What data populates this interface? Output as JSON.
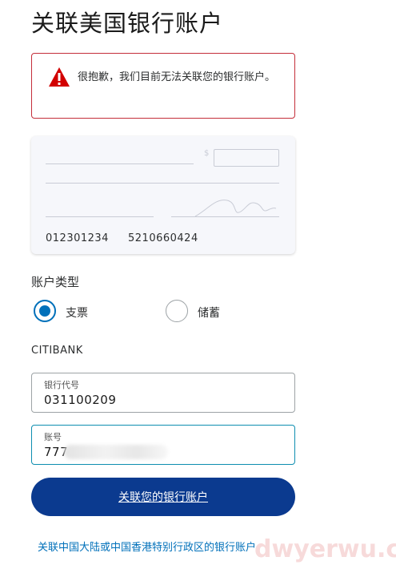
{
  "page": {
    "title": "关联美国银行账户"
  },
  "alert": {
    "message": "很抱歉，我们目前无法关联您的银行账户。",
    "icon": "warning-icon",
    "color": "#c42e3a"
  },
  "check": {
    "currency_symbol": "$",
    "routing_number": "012301234",
    "account_number": "5210660424"
  },
  "account_type": {
    "label": "账户类型",
    "options": [
      {
        "label": "支票",
        "selected": true
      },
      {
        "label": "储蓄",
        "selected": false
      }
    ]
  },
  "bank": {
    "name": "CITIBANK"
  },
  "routing_field": {
    "label": "银行代号",
    "value": "031100209"
  },
  "account_field": {
    "label": "账号",
    "value": "777"
  },
  "submit": {
    "label": "关联您的银行账户",
    "color": "#0b3a8f"
  },
  "china_link": {
    "label": "关联中国大陆或中国香港特别行政区的银行账户"
  },
  "watermark": {
    "text": "dwyerwu.com"
  }
}
